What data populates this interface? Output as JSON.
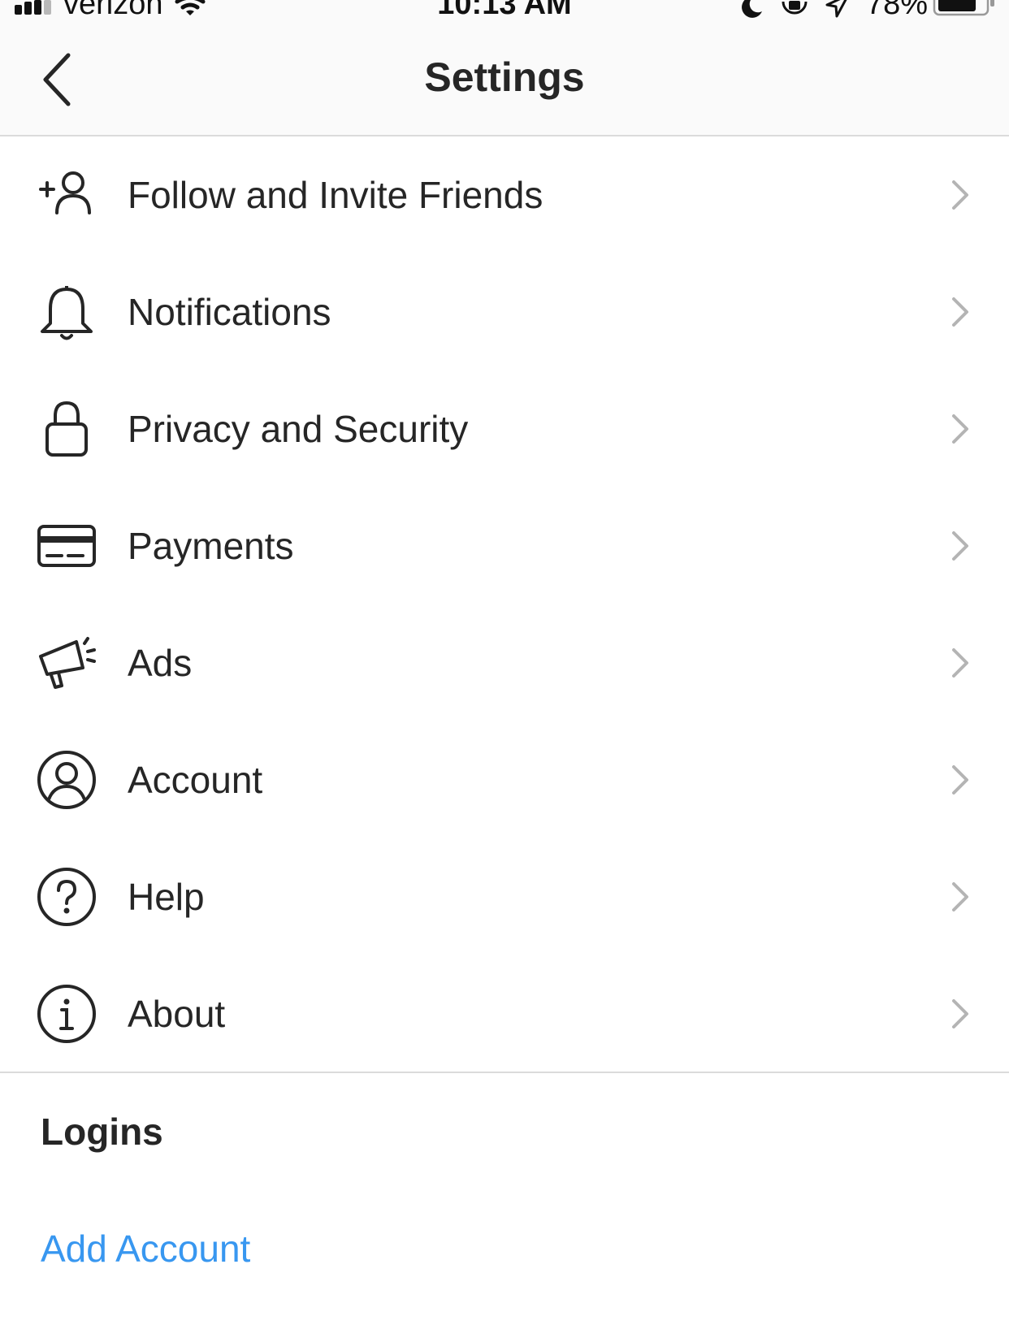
{
  "status_bar": {
    "carrier": "verizon",
    "time": "10:13 AM",
    "battery_percent": "78%"
  },
  "nav": {
    "title": "Settings",
    "back_icon": "chevron-left-icon"
  },
  "menu": [
    {
      "label": "Follow and Invite Friends",
      "icon": "add-user-icon"
    },
    {
      "label": "Notifications",
      "icon": "bell-icon"
    },
    {
      "label": "Privacy and Security",
      "icon": "lock-icon"
    },
    {
      "label": "Payments",
      "icon": "credit-card-icon"
    },
    {
      "label": "Ads",
      "icon": "megaphone-icon"
    },
    {
      "label": "Account",
      "icon": "user-circle-icon"
    },
    {
      "label": "Help",
      "icon": "help-circle-icon"
    },
    {
      "label": "About",
      "icon": "info-circle-icon"
    }
  ],
  "logins": {
    "header": "Logins",
    "add_account": "Add Account"
  },
  "colors": {
    "link": "#3897f0",
    "text": "#262626",
    "chevron": "#b4b4b4",
    "divider": "#dbdbdb",
    "nav_background": "#fafafa"
  }
}
